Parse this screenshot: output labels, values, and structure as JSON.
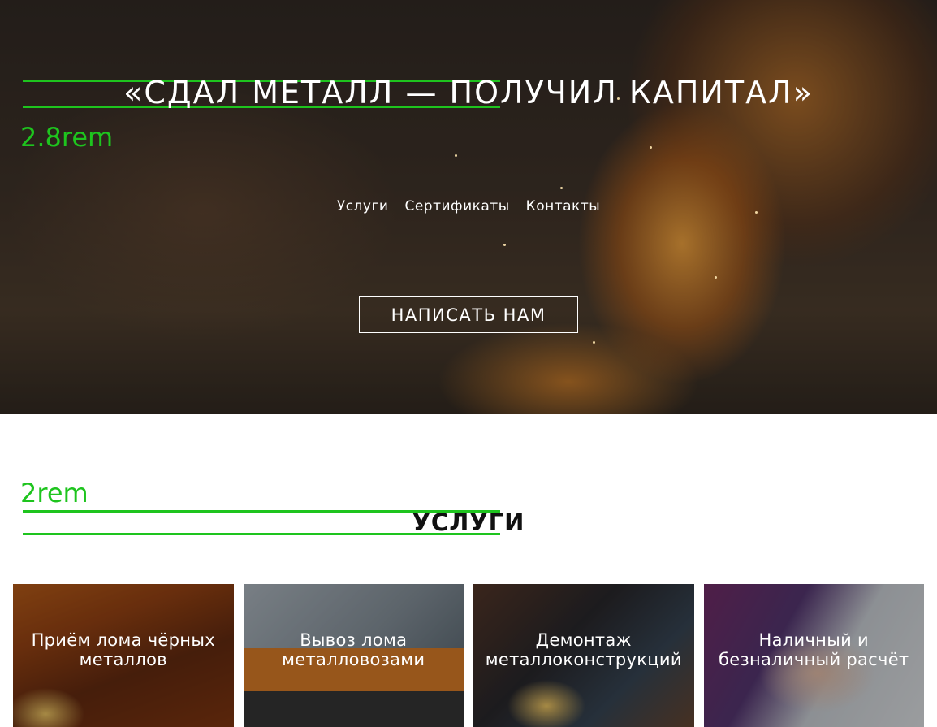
{
  "hero": {
    "title": "«СДАЛ МЕТАЛЛ — ПОЛУЧИЛ КАПИТАЛ»",
    "size_note": "2.8rem",
    "nav": [
      "Услуги",
      "Сертификаты",
      "Контакты"
    ],
    "cta_label": "НАПИСАТЬ НАМ"
  },
  "services": {
    "size_note": "2rem",
    "title": "УСЛУГИ",
    "cards": [
      "Приём лома чёрных металлов",
      "Вывоз лома металловозами",
      "Демонтаж металлоконструкций",
      "Наличный и безналичный расчёт"
    ]
  },
  "colors": {
    "accent": "#1ec41e",
    "text_dark": "#111111",
    "text_light": "#ffffff"
  }
}
